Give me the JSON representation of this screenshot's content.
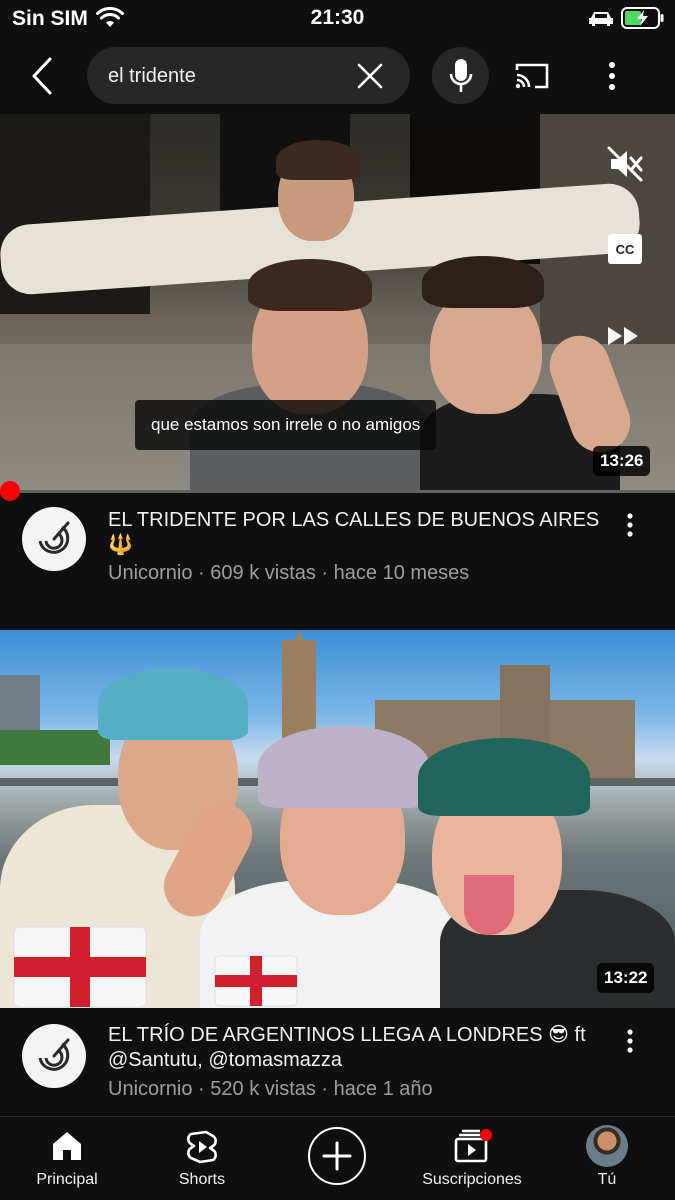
{
  "status_bar": {
    "carrier": "Sin SIM",
    "time": "21:30"
  },
  "search": {
    "query": "el tridente"
  },
  "videos": [
    {
      "title": "EL TRIDENTE POR LAS CALLES DE BUENOS AIRES 🔱",
      "channel": "Unicornio",
      "views": "609 k vistas",
      "age": "hace 10 meses",
      "duration": "13:26",
      "caption": "que estamos son irrele o no amigos",
      "cc_label": "CC",
      "progress": 0.01
    },
    {
      "title": "EL TRÍO DE ARGENTINOS LLEGA A LONDRES 😎 ft @Santutu, @tomasmazza",
      "channel": "Unicornio",
      "views": "520 k vistas",
      "age": "hace 1 año",
      "duration": "13:22"
    }
  ],
  "separator": " · ",
  "nav": [
    {
      "label": "Principal",
      "icon": "home-icon"
    },
    {
      "label": "Shorts",
      "icon": "shorts-icon"
    },
    {
      "label": "",
      "icon": "create-icon"
    },
    {
      "label": "Suscripciones",
      "icon": "subscriptions-icon"
    },
    {
      "label": "Tú",
      "icon": "avatar"
    }
  ],
  "colors": {
    "background": "#0f0f0f",
    "accent_red": "#ff0000",
    "secondary_text": "#9e9e9e"
  }
}
